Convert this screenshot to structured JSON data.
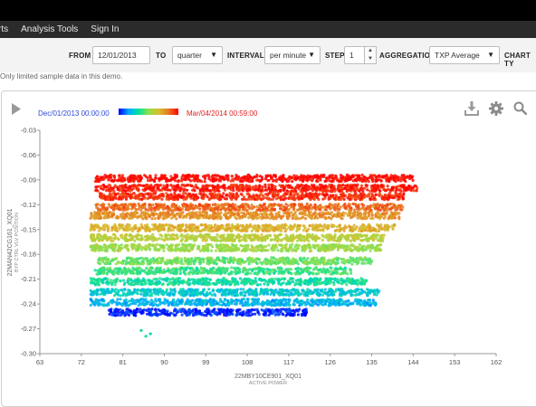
{
  "menu": {
    "items": [
      {
        "label": "rts"
      },
      {
        "label": "Analysis Tools"
      },
      {
        "label": "Sign In"
      }
    ]
  },
  "controls": {
    "from_label": "FROM",
    "from_value": "12/01/2013",
    "to_label": "TO",
    "to_value": "quarter",
    "interval_label": "INTERVAL",
    "interval_value": "per minute",
    "step_label": "STEP",
    "step_value": "1",
    "aggregation_label": "AGGREGATION",
    "aggregation_value": "TXP Average",
    "chart_type_label": "CHART TY"
  },
  "notice": "Only limited sample data in this demo.",
  "legend": {
    "start": "Dec/01/2013 00:00:00",
    "end": "Mar/04/2014 00:59:00",
    "gradient_colors": [
      "#0000ff",
      "#00aaff",
      "#00e0a0",
      "#8fe04a",
      "#d8c030",
      "#e87a20",
      "#ff0000"
    ]
  },
  "icons": [
    "play-icon",
    "download-icon",
    "gear-icon",
    "search-icon"
  ],
  "chart_data": {
    "type": "scatter",
    "xlabel": "22MBY10CE901_XQ01",
    "xlabel_sub": "ACTIVE POWER",
    "ylabel": "22MAN42CG161_XQ01",
    "ylabel_sub": "BYP CTRL VLV POSITION",
    "xlim": [
      63,
      162
    ],
    "ylim": [
      -0.3,
      -0.03
    ],
    "x_ticks": [
      "63",
      "72",
      "81",
      "90",
      "99",
      "108",
      "117",
      "126",
      "135",
      "144",
      "153",
      "162"
    ],
    "y_ticks": [
      "-0.03",
      "-0.06",
      "-0.09",
      "-0.12",
      "-0.15",
      "-0.18",
      "-0.21",
      "-0.24",
      "-0.27",
      "-0.30"
    ],
    "color_by": "time",
    "bands": [
      {
        "y": -0.088,
        "x_min": 75,
        "x_max": 144,
        "time": 1.0
      },
      {
        "y": -0.1,
        "x_min": 75,
        "x_max": 145,
        "time": 0.97
      },
      {
        "y": -0.11,
        "x_min": 76,
        "x_max": 142,
        "time": 0.94
      },
      {
        "y": -0.123,
        "x_min": 75,
        "x_max": 142,
        "time": 0.86
      },
      {
        "y": -0.133,
        "x_min": 74,
        "x_max": 141,
        "time": 0.78
      },
      {
        "y": -0.148,
        "x_min": 74,
        "x_max": 140,
        "time": 0.7
      },
      {
        "y": -0.16,
        "x_min": 74,
        "x_max": 138,
        "time": 0.6
      },
      {
        "y": -0.172,
        "x_min": 74,
        "x_max": 137,
        "time": 0.53
      },
      {
        "y": -0.188,
        "x_min": 75,
        "x_max": 135,
        "time": 0.46
      },
      {
        "y": -0.2,
        "x_min": 75,
        "x_max": 131,
        "time": 0.4
      },
      {
        "y": -0.213,
        "x_min": 74,
        "x_max": 134,
        "time": 0.34
      },
      {
        "y": -0.226,
        "x_min": 74,
        "x_max": 137,
        "time": 0.26
      },
      {
        "y": -0.238,
        "x_min": 74,
        "x_max": 136,
        "time": 0.2
      },
      {
        "y": -0.25,
        "x_min": 78,
        "x_max": 121,
        "time": 0.03
      }
    ],
    "outliers": [
      {
        "x": 85,
        "y": -0.272,
        "time": 0.35
      },
      {
        "x": 87,
        "y": -0.276,
        "time": 0.3
      },
      {
        "x": 86,
        "y": -0.279,
        "time": 0.32
      }
    ]
  }
}
